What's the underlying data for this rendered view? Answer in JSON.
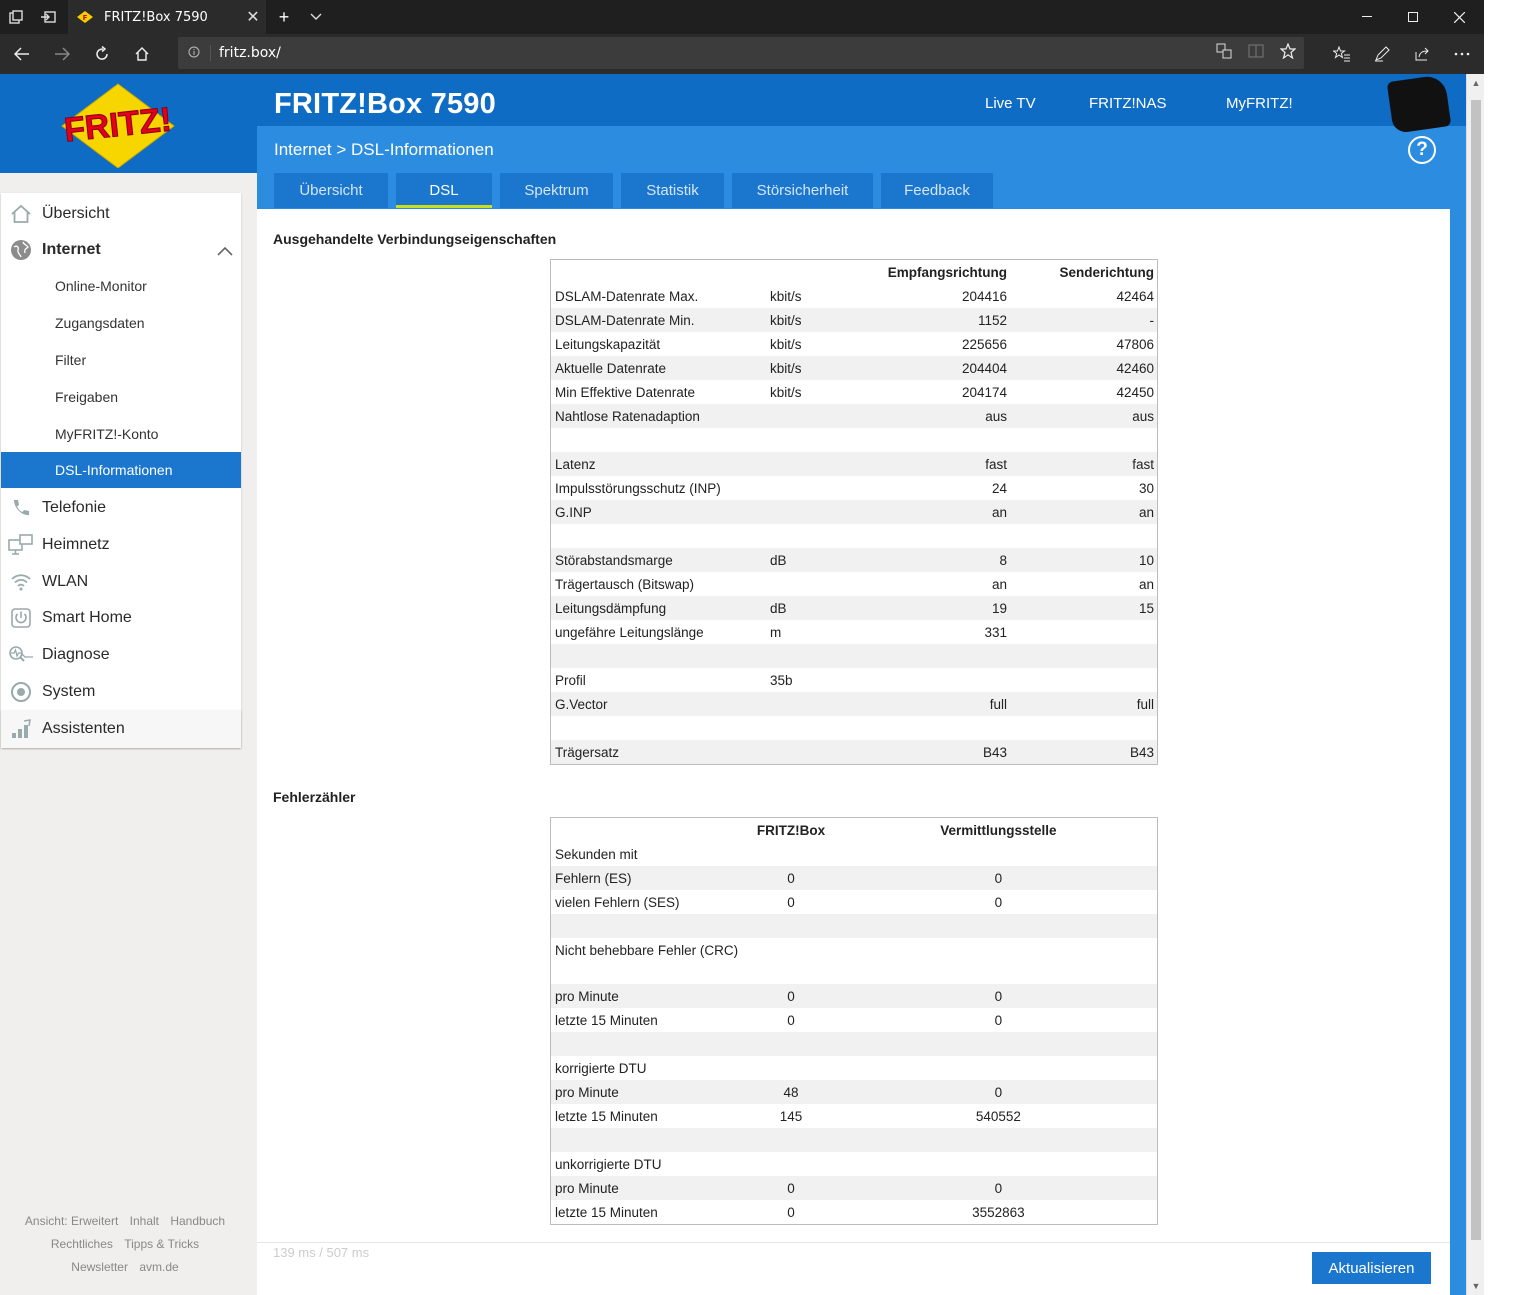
{
  "browser": {
    "tab_title": "FRITZ!Box 7590",
    "tab_close": "✕",
    "new_tab": "+",
    "url": "fritz.box/"
  },
  "header": {
    "product": "FRITZ!Box 7590",
    "links": [
      "Live TV",
      "FRITZ!NAS",
      "MyFRITZ!"
    ],
    "breadcrumb": "Internet > DSL-Informationen",
    "help": "?"
  },
  "tabs": [
    {
      "label": "Übersicht"
    },
    {
      "label": "DSL"
    },
    {
      "label": "Spektrum"
    },
    {
      "label": "Statistik"
    },
    {
      "label": "Störsicherheit"
    },
    {
      "label": "Feedback"
    }
  ],
  "sidebar": {
    "items": [
      {
        "label": "Übersicht"
      },
      {
        "label": "Internet"
      },
      {
        "label": "Telefonie"
      },
      {
        "label": "Heimnetz"
      },
      {
        "label": "WLAN"
      },
      {
        "label": "Smart Home"
      },
      {
        "label": "Diagnose"
      },
      {
        "label": "System"
      }
    ],
    "sub_items": [
      {
        "label": "Online-Monitor"
      },
      {
        "label": "Zugangsdaten"
      },
      {
        "label": "Filter"
      },
      {
        "label": "Freigaben"
      },
      {
        "label": "MyFRITZ!-Konto"
      },
      {
        "label": "DSL-Informationen"
      }
    ],
    "assistants": "Assistenten"
  },
  "footer": {
    "line1": [
      "Ansicht: Erweitert",
      "Inhalt",
      "Handbuch"
    ],
    "line2": [
      "Rechtliches",
      "Tipps & Tricks"
    ],
    "line3": [
      "Newsletter",
      "avm.de"
    ]
  },
  "section1": {
    "title": "Ausgehandelte Verbindungseigenschaften",
    "header": {
      "down": "Empfangsrichtung",
      "up": "Senderichtung"
    },
    "rows": [
      {
        "label": "DSLAM-Datenrate Max.",
        "unit": "kbit/s",
        "down": "204416",
        "up": "42464"
      },
      {
        "label": "DSLAM-Datenrate Min.",
        "unit": "kbit/s",
        "down": "1152",
        "up": "-"
      },
      {
        "label": "Leitungskapazität",
        "unit": "kbit/s",
        "down": "225656",
        "up": "47806"
      },
      {
        "label": "Aktuelle Datenrate",
        "unit": "kbit/s",
        "down": "204404",
        "up": "42460"
      },
      {
        "label": "Min Effektive Datenrate",
        "unit": "kbit/s",
        "down": "204174",
        "up": "42450"
      },
      {
        "label": "Nahtlose Ratenadaption",
        "unit": "",
        "down": "aus",
        "up": "aus"
      },
      {
        "label": "",
        "unit": "",
        "down": "",
        "up": ""
      },
      {
        "label": "Latenz",
        "unit": "",
        "down": "fast",
        "up": "fast"
      },
      {
        "label": "Impulsstörungsschutz (INP)",
        "unit": "",
        "down": "24",
        "up": "30"
      },
      {
        "label": "G.INP",
        "unit": "",
        "down": "an",
        "up": "an"
      },
      {
        "label": "",
        "unit": "",
        "down": "",
        "up": ""
      },
      {
        "label": "Störabstandsmarge",
        "unit": "dB",
        "down": "8",
        "up": "10"
      },
      {
        "label": "Trägertausch (Bitswap)",
        "unit": "",
        "down": "an",
        "up": "an"
      },
      {
        "label": "Leitungsdämpfung",
        "unit": "dB",
        "down": "19",
        "up": "15"
      },
      {
        "label": "ungefähre Leitungslänge",
        "unit": "m",
        "down": "331",
        "up": ""
      },
      {
        "label": "",
        "unit": "",
        "down": "",
        "up": ""
      },
      {
        "label": "Profil",
        "unit": "35b",
        "down": "",
        "up": ""
      },
      {
        "label": "G.Vector",
        "unit": "",
        "down": "full",
        "up": "full"
      },
      {
        "label": "",
        "unit": "",
        "down": "",
        "up": ""
      },
      {
        "label": "Trägersatz",
        "unit": "",
        "down": "B43",
        "up": "B43"
      }
    ]
  },
  "section2": {
    "title": "Fehlerzähler",
    "header": {
      "fritzbox": "FRITZ!Box",
      "vst": "Vermittlungsstelle"
    },
    "rows": [
      {
        "label": "Sekunden mit",
        "fb": "",
        "vs": ""
      },
      {
        "label": "Fehlern (ES)",
        "fb": "0",
        "vs": "0"
      },
      {
        "label": "vielen Fehlern (SES)",
        "fb": "0",
        "vs": "0"
      },
      {
        "label": "",
        "fb": "",
        "vs": ""
      },
      {
        "label": "Nicht behebbare Fehler (CRC)",
        "fb": "",
        "vs": ""
      },
      {
        "label": "pro Minute",
        "fb": "0",
        "vs": "0"
      },
      {
        "label": "letzte 15 Minuten",
        "fb": "0",
        "vs": "0"
      },
      {
        "label": "",
        "fb": "",
        "vs": ""
      },
      {
        "label": "korrigierte DTU",
        "fb": "",
        "vs": ""
      },
      {
        "label": "pro Minute",
        "fb": "48",
        "vs": "0"
      },
      {
        "label": "letzte 15 Minuten",
        "fb": "145",
        "vs": "540552"
      },
      {
        "label": "",
        "fb": "",
        "vs": ""
      },
      {
        "label": "unkorrigierte DTU",
        "fb": "",
        "vs": ""
      },
      {
        "label": "pro Minute",
        "fb": "0",
        "vs": "0"
      },
      {
        "label": "letzte 15 Minuten",
        "fb": "0",
        "vs": "3552863"
      }
    ]
  },
  "timing": "139 ms / 507 ms",
  "refresh_label": "Aktualisieren",
  "colors": {
    "brand_blue": "#0e6cc4",
    "light_blue": "#2c8ce0",
    "tab_blue": "#1b76cd",
    "active_underline": "#c8e01c"
  }
}
